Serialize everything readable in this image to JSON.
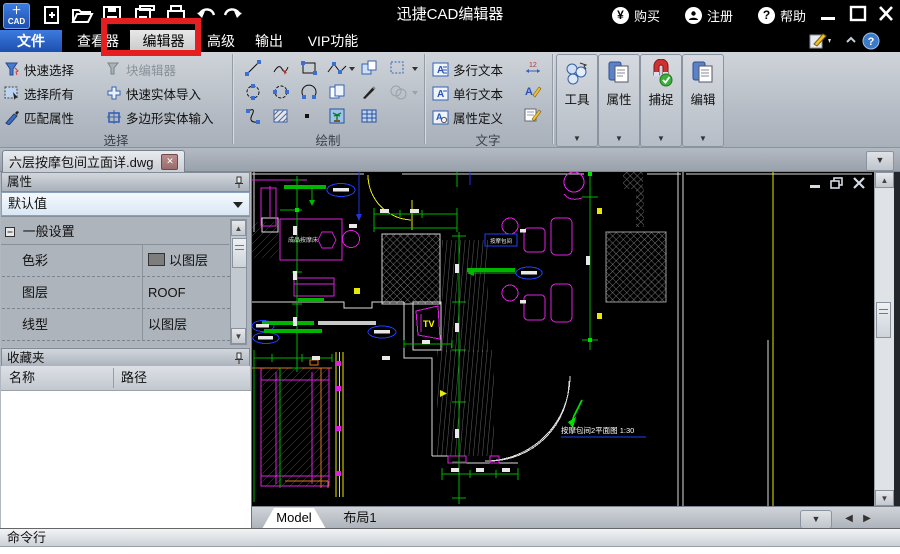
{
  "title_bar": {
    "app_title": "迅捷CAD编辑器",
    "buy": "购买",
    "register": "注册",
    "help": "帮助"
  },
  "menu": {
    "tabs": [
      "文件",
      "查看器",
      "编辑器",
      "高级",
      "输出",
      "VIP功能"
    ]
  },
  "ribbon": {
    "select_group": {
      "label": "选择",
      "col1": [
        "快速选择",
        "选择所有",
        "匹配属性"
      ],
      "col2": [
        "块编辑器",
        "快速实体导入",
        "多边形实体输入"
      ]
    },
    "draw_group": {
      "label": "绘制"
    },
    "text_group": {
      "label": "文字",
      "items": [
        "多行文本",
        "单行文本",
        "属性定义"
      ]
    },
    "panels": [
      {
        "label": "工具"
      },
      {
        "label": "属性"
      },
      {
        "label": "捕捉"
      },
      {
        "label": "编辑"
      }
    ]
  },
  "document_tabs": {
    "active": "六层按摩包间立面详.dwg"
  },
  "properties_panel": {
    "title": "属性",
    "preset": "默认值",
    "section": "一般设置",
    "rows": [
      {
        "label": "色彩",
        "value": "以图层"
      },
      {
        "label": "图层",
        "value": "ROOF"
      },
      {
        "label": "线型",
        "value": "以图层"
      }
    ]
  },
  "favorites_panel": {
    "title": "收藏夹",
    "col_name": "名称",
    "col_path": "路径"
  },
  "canvas": {
    "labels": {
      "bed": "成品按摩床",
      "room_tag": "按摩包间",
      "tv": "TV",
      "plan_title": "按摩包间2平面图 1:30"
    }
  },
  "layout_tabs": {
    "model": "Model",
    "layout1": "布局1"
  },
  "command_bar": {
    "label": "命令行"
  },
  "colors": {
    "annotation_red": "#e51f1f",
    "cad_green": "#00b400",
    "cad_magenta": "#e020e0",
    "cad_yellow": "#e8e800",
    "accent_blue": "#2a6cd8"
  }
}
